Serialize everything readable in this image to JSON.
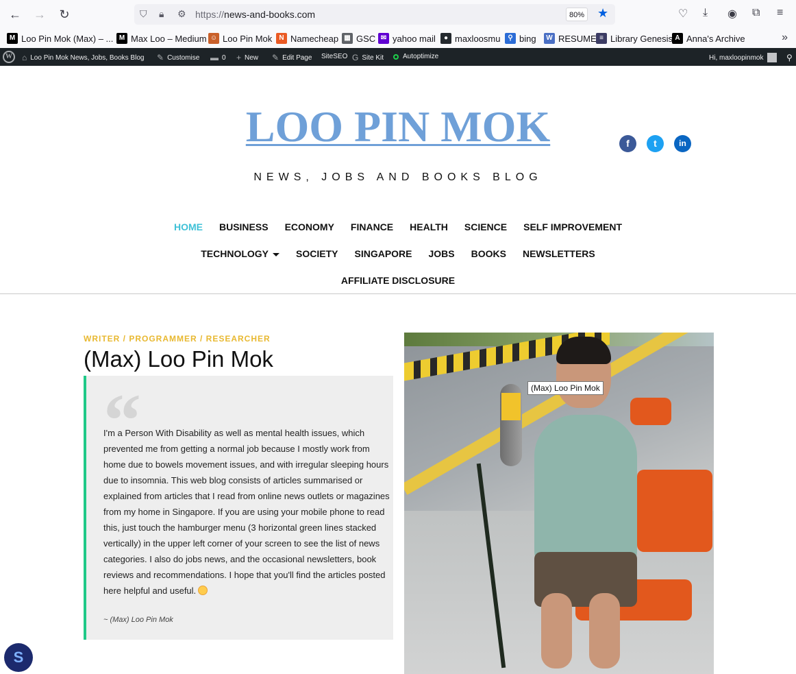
{
  "browser": {
    "url_scheme": "https://",
    "url_host": "news-and-books.com",
    "zoom": "80%"
  },
  "bookmarks": [
    {
      "label": "Loo Pin Mok (Max) – ...",
      "icon": "medium-icon",
      "color": "#000000",
      "glyph": "M"
    },
    {
      "label": "Max Loo – Medium",
      "icon": "medium-icon",
      "color": "#000000",
      "glyph": "M"
    },
    {
      "label": "Loo Pin Mok",
      "icon": "avatar-icon",
      "color": "#c9602a",
      "glyph": "☺"
    },
    {
      "label": "Namecheap",
      "icon": "namecheap-icon",
      "color": "#ea5a24",
      "glyph": "N"
    },
    {
      "label": "GSC",
      "icon": "gsc-icon",
      "color": "#5f6368",
      "glyph": "▦"
    },
    {
      "label": "yahoo mail",
      "icon": "yahoo-mail-icon",
      "color": "#6001d2",
      "glyph": "✉"
    },
    {
      "label": "maxloosmu",
      "icon": "github-icon",
      "color": "#24292e",
      "glyph": "●"
    },
    {
      "label": "bing",
      "icon": "search-icon",
      "color": "#2b6cd6",
      "glyph": "⚲"
    },
    {
      "label": "RESUME",
      "icon": "wordpress-icon",
      "color": "#4a6fc4",
      "glyph": "W"
    },
    {
      "label": "Library Genesis",
      "icon": "library-icon",
      "color": "#3c3c64",
      "glyph": "≡"
    },
    {
      "label": "Anna's Archive",
      "icon": "annas-archive-icon",
      "color": "#000000",
      "glyph": "A"
    }
  ],
  "adminbar": {
    "site": "Loo Pin Mok News, Jobs, Books Blog",
    "customise": "Customise",
    "comments": "0",
    "new": "New",
    "edit_page": "Edit Page",
    "siteseo": "SiteSEO",
    "site_kit": "Site Kit",
    "autoptimize": "Autoptimize",
    "greeting": "Hi, maxloopinmok"
  },
  "header": {
    "title": "LOO PIN MOK",
    "tagline": "NEWS, JOBS AND BOOKS BLOG"
  },
  "menu": {
    "row1": [
      "HOME",
      "BUSINESS",
      "ECONOMY",
      "FINANCE",
      "HEALTH",
      "SCIENCE",
      "SELF IMPROVEMENT"
    ],
    "row2": [
      "TECHNOLOGY",
      "SOCIETY",
      "SINGAPORE",
      "JOBS",
      "BOOKS",
      "NEWSLETTERS"
    ],
    "row3": [
      "AFFILIATE DISCLOSURE"
    ]
  },
  "content": {
    "kicker": "WRITER / PROGRAMMER / RESEARCHER",
    "name": "(Max) Loo Pin Mok",
    "quote": "I'm a Person With Disability as well as mental health issues, which prevented me from getting a normal job because I mostly work from home due to bowels movement issues, and with irregular sleeping hours due to insomnia. This web blog consists of articles summarised or explained from articles that I read from online news outlets or magazines from my home in Singapore. If you are using your mobile phone to read this, just touch the hamburger menu (3 horizontal green lines stacked vertically) in the upper left corner of your screen to see the list of news categories. I also do jobs news, and the occasional newsletters, book reviews and recommendations. I hope that you'll find the articles posted here helpful and useful.",
    "signature": "~ (Max) Loo Pin Mok",
    "photo_tooltip": "(Max) Loo Pin Mok"
  },
  "colors": {
    "title": "#6fa0d8",
    "active_menu": "#3fc1d7",
    "kicker": "#e8b830",
    "quote_border": "#1fc988"
  }
}
